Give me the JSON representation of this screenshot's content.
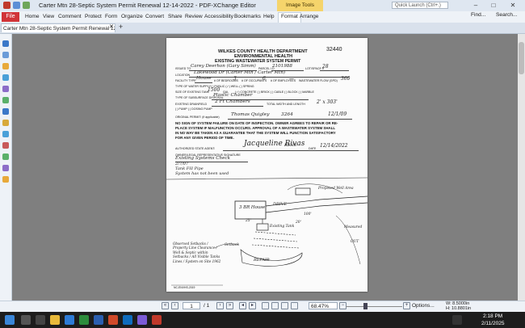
{
  "window": {
    "title": "Carter Mtn 28-Septic System Permit Renewal 12-14-2022 - PDF-XChange Editor",
    "context_tab": "Image Tools",
    "quick_launch_placeholder": "Quick Launch (Ctrl+.)",
    "minimize": "–",
    "maximize": "□",
    "close": "✕"
  },
  "ribbon": {
    "file": "File",
    "tabs": [
      "Home",
      "View",
      "Comment",
      "Protect",
      "Form",
      "Organize",
      "Convert",
      "Share",
      "Review",
      "Accessibility",
      "Bookmarks",
      "Help",
      "Format",
      "Arrange"
    ],
    "find": "Find...",
    "search": "Search..."
  },
  "doc_tab": {
    "label": "Carter Mtn 28-Septic System Permit Renewal 12-14-20...",
    "close": "✕",
    "new_tab": "+"
  },
  "document": {
    "permit_number": "32440",
    "header1": "WILKES COUNTY HEALTH DEPARTMENT",
    "header2": "ENVIRONMENTAL HEALTH",
    "header3": "EXISTING WASTEWATER SYSTEM PERMIT",
    "issued_to_label": "ISSUED TO",
    "issued_to_value": "Carey Deerhon (Gary Simm)",
    "parcel_label": "PARCEL I.D.",
    "parcel_value": "2101988",
    "lot_label": "LOT/SPACE #",
    "lot_value": "28",
    "location_label": "LOCATION",
    "location_value": "Lakewood Dr (Carter Mtn / Carter Mtn)",
    "facility_label": "FACILITY TYPE",
    "facility_value": "House",
    "bedrooms_label": "# OF BEDROOMS",
    "bedrooms_value": "3",
    "occupants_label": "# OF OCCUPANTS",
    "occupants_value": "6",
    "employees_label": "# OF EMPLOYEES",
    "employees_value": "—",
    "wastewater_label": "WASTEWATER FLOW (GPD)",
    "wastewater_value": "360",
    "water_supply_label": "TYPE OF WATER SUPPLY",
    "water_supply_options": "( ) PUBLIC  (✓) WELL  ( ) SPRING",
    "tank_label": "SIZE OF EXISTING TANK",
    "tank_value": "1500",
    "tank_gal": "GAL",
    "tank_options": "(✓) CONCRETE  ( ) BRICK  ( ) CABLE  ( ) BLOCK  ( ) MARBLE",
    "drainfield_label": "TYPE OF SUBSURFACE DISPOSAL",
    "drainfield_value": "Plastic Chamber",
    "existing_label": "EXISTING DRAINFIELD",
    "existing_value": "2 Ft Chambers",
    "total_width_label": "TOTAL WIDTH AND LENGTH",
    "total_width_value": "2' x 303'",
    "pump_label": "( ) PUMP  ( ) DOSING PUMP",
    "original_permit_label": "ORIGINAL PERMIT: (if applicable)",
    "original_permit_value": "Thomas Quigley",
    "original_permit_num": "3264",
    "original_permit_date": "12/1/09",
    "warning1": "NO SIGN OF SYSTEM FAILURE ON DATE OF INSPECTION. OWNER AGREES TO REPAIR OR RE-",
    "warning2": "PLACE SYSTEM IF MALFUNCTION OCCURS. APPROVAL OF A WASTEWATER SYSTEM SHALL",
    "warning3": "IN NO WAY BE TAKEN AS A GUARANTEE THAT THE SYSTEM WILL FUNCTION SATISFACTORY",
    "warning4": "FOR ANY GIVEN PERIOD OF TIME.",
    "agent_label": "AUTHORIZED STATE AGENT:",
    "agent_signature": "Jacqueline Rivas",
    "agent_title": "REHS",
    "date_label": "DATE",
    "date_value": "12/14/2022",
    "owner_label": "OWNER/LEGAL REPRESENTATIVE SIGNATURE",
    "owner_value": "Existing Systems Check",
    "note1": "2/7/07",
    "note2": "Tank Fill Pipe",
    "note3": "System has not been used",
    "sketch_house": "3 BR House",
    "sketch_driveway": "DRIVE",
    "sketch_well": "Proposed Well Area",
    "sketch_tank": "Existing Tank",
    "sketch_repair": "REPAIR",
    "sketch_setback": "Observed Setbacks / Property Line Clearance / Well & Septic within Setbacks / All Visible Tanks Lines / System on Site 1962",
    "sketch_nc": "NC-ENVHS-2019",
    "sketch_dim1": "25'",
    "sketch_dim2": "20'",
    "sketch_dim3": "100'",
    "sketch_label_easement": "Setback",
    "sketch_label_out": "OUT",
    "sketch_measure": "Measured"
  },
  "status": {
    "page_current": "1",
    "page_total": "/ 1",
    "zoom": "68.47%",
    "options": "Options...",
    "width_readout": "W: 8.5000in",
    "height_readout": "H: 10.8801in"
  },
  "taskbar": {
    "time": "2:18 PM",
    "date": "2/11/2025"
  },
  "colors": {
    "file_tab": "#d13438",
    "context_tab": "#f5d46b",
    "workspace": "#7f7f7f"
  }
}
